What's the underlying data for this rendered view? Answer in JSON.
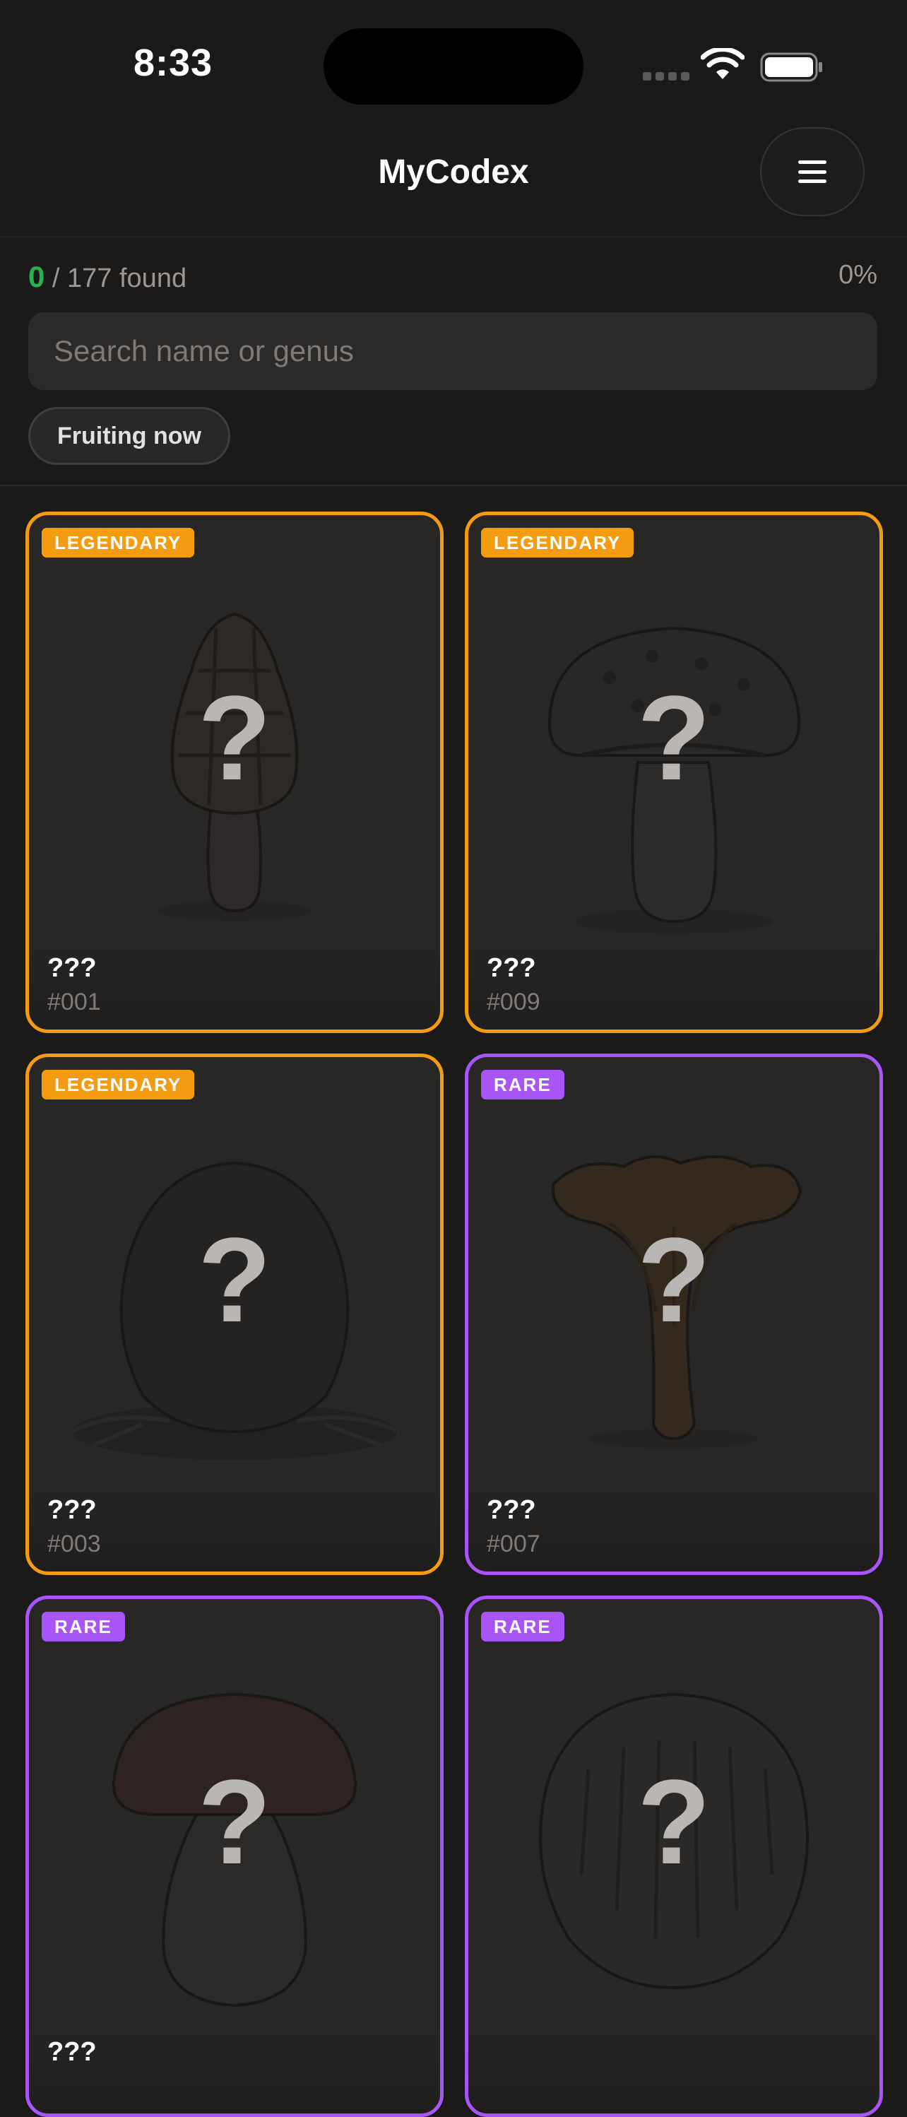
{
  "status_bar": {
    "time": "8:33"
  },
  "header": {
    "title": "MyCodex"
  },
  "progress": {
    "found": "0",
    "total_text": " / 177 found",
    "percent": "0%"
  },
  "search": {
    "placeholder": "Search name or genus",
    "value": ""
  },
  "filters": {
    "fruiting_now": "Fruiting now"
  },
  "cards": [
    {
      "rarity": "LEGENDARY",
      "name": "???",
      "number": "#001",
      "icon": "morel-silhouette",
      "unknown_glyph": "?"
    },
    {
      "rarity": "LEGENDARY",
      "name": "???",
      "number": "#009",
      "icon": "shaggy-cap-mushroom-silhouette",
      "unknown_glyph": "?"
    },
    {
      "rarity": "LEGENDARY",
      "name": "???",
      "number": "#003",
      "icon": "truffle-silhouette",
      "unknown_glyph": "?"
    },
    {
      "rarity": "RARE",
      "name": "???",
      "number": "#007",
      "icon": "chanterelle-silhouette",
      "unknown_glyph": "?"
    },
    {
      "rarity": "RARE",
      "name": "???",
      "number": "",
      "icon": "bolete-silhouette",
      "unknown_glyph": "?"
    },
    {
      "rarity": "RARE",
      "name": "",
      "number": "",
      "icon": "lions-mane-silhouette",
      "unknown_glyph": "?"
    }
  ],
  "colors": {
    "legendary": "#f39c12",
    "rare": "#a855f7",
    "found_count": "#27b24f",
    "background": "#1c1a19"
  }
}
